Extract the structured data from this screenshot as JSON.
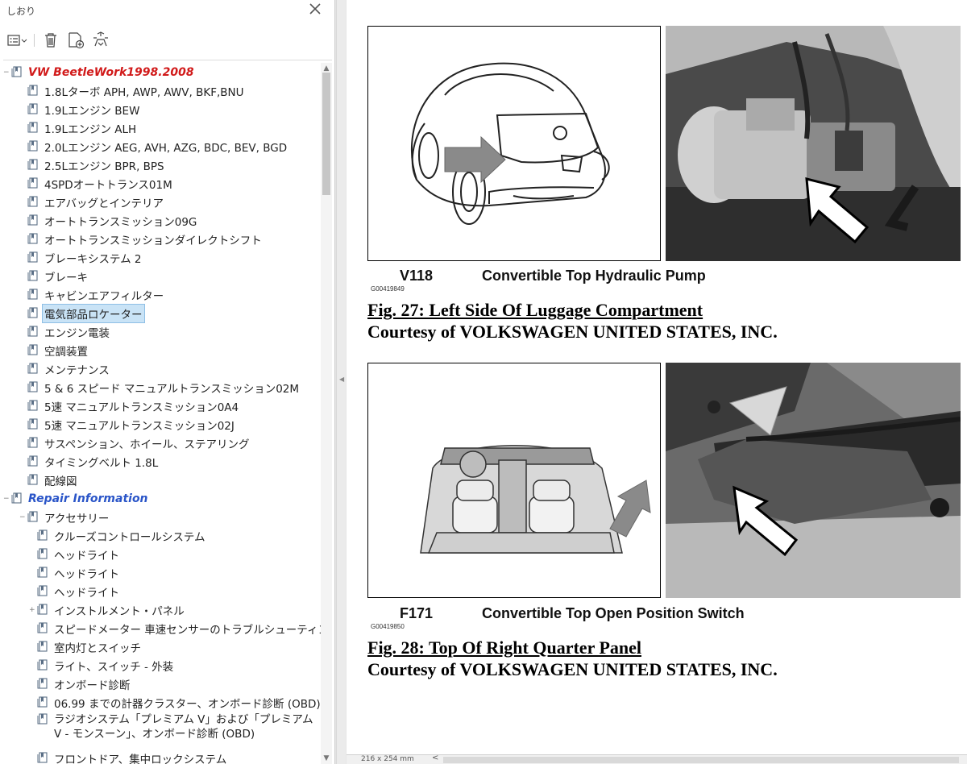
{
  "bookmarks_panel": {
    "title": "しおり",
    "tree": [
      {
        "label": "VW BeetleWork1998.2008",
        "level": 0,
        "style": "root1",
        "expander": "⊟"
      },
      {
        "label": "1.8Lターボ APH, AWP, AWV, BKF,BNU",
        "level": 1
      },
      {
        "label": "1.9Lエンジン BEW",
        "level": 1
      },
      {
        "label": "1.9Lエンジン ALH",
        "level": 1
      },
      {
        "label": "2.0Lエンジン AEG, AVH, AZG, BDC, BEV, BGD",
        "level": 1
      },
      {
        "label": "2.5Lエンジン BPR, BPS",
        "level": 1
      },
      {
        "label": "4SPDオートトランス01M",
        "level": 1
      },
      {
        "label": "エアバッグとインテリア",
        "level": 1
      },
      {
        "label": "オートトランスミッション09G",
        "level": 1
      },
      {
        "label": "オートトランスミッションダイレクトシフト",
        "level": 1
      },
      {
        "label": "ブレーキシステム 2",
        "level": 1
      },
      {
        "label": "ブレーキ",
        "level": 1
      },
      {
        "label": "キャビンエアフィルター",
        "level": 1
      },
      {
        "label": "電気部品ロケーター",
        "level": 1,
        "selected": true
      },
      {
        "label": "エンジン電装",
        "level": 1
      },
      {
        "label": "空調装置",
        "level": 1
      },
      {
        "label": "メンテナンス",
        "level": 1
      },
      {
        "label": "5 & 6 スピード マニュアルトランスミッション02M",
        "level": 1
      },
      {
        "label": "5速 マニュアルトランスミッション0A4",
        "level": 1
      },
      {
        "label": "5速 マニュアルトランスミッション02J",
        "level": 1
      },
      {
        "label": "サスペンション、ホイール、ステアリング",
        "level": 1
      },
      {
        "label": "タイミングベルト 1.8L",
        "level": 1
      },
      {
        "label": "配線図",
        "level": 1
      },
      {
        "label": "Repair Information",
        "level": 0,
        "style": "root2",
        "expander": "⊟"
      },
      {
        "label": "アクセサリー",
        "level": 1,
        "expander": "⊟"
      },
      {
        "label": "クルーズコントロールシステム",
        "level": 2
      },
      {
        "label": "ヘッドライト",
        "level": 2
      },
      {
        "label": "ヘッドライト",
        "level": 2
      },
      {
        "label": "ヘッドライト",
        "level": 2
      },
      {
        "label": "インストルメント・パネル",
        "level": 2,
        "expander": "⊞"
      },
      {
        "label": "スピードメーター 車速センサーのトラブルシューティング",
        "level": 2
      },
      {
        "label": "室内灯とスイッチ",
        "level": 2
      },
      {
        "label": "ライト、スイッチ - 外装",
        "level": 2
      },
      {
        "label": "オンボード診断",
        "level": 2
      },
      {
        "label": "06.99 までの計器クラスター、オンボード診断 (OBD)",
        "level": 2
      },
      {
        "label": "ラジオシステム「プレミアム V」および「プレミアム V - モンスーン」、オンボード診断 (OBD)",
        "level": 2,
        "twoline": true
      },
      {
        "label": "フロントドア、集中ロックシステム",
        "level": 2
      }
    ]
  },
  "document": {
    "figures": [
      {
        "code": "V118",
        "description": "Convertible Top Hydraulic Pump",
        "image_id": "G00419849",
        "title": "Fig. 27: Left Side Of Luggage Compartment",
        "courtesy": "Courtesy of VOLKSWAGEN UNITED STATES, INC."
      },
      {
        "code": "F171",
        "description": "Convertible Top Open Position Switch",
        "image_id": "G00419850",
        "title": "Fig. 28: Top Of Right Quarter Panel",
        "courtesy": "Courtesy of VOLKSWAGEN UNITED STATES, INC."
      }
    ]
  },
  "status_bar": {
    "page_size": "216 x 254 mm"
  },
  "icons": {
    "close": "close-icon",
    "options": "options-menu-icon",
    "delete": "delete-bookmark-icon",
    "new_bookmark": "new-bookmark-icon",
    "find_bookmark": "find-current-bookmark-icon",
    "bookmark": "bookmark-icon"
  },
  "colors": {
    "selection": "#c9e3f6",
    "root_red": "#d11a1a",
    "root_blue": "#2a55c8"
  }
}
